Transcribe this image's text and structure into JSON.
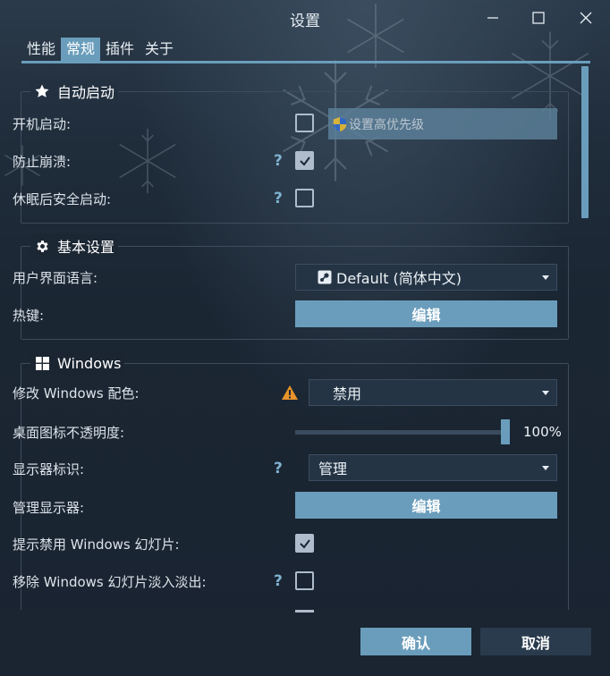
{
  "window": {
    "title": "设置"
  },
  "tabs": [
    "性能",
    "常规",
    "插件",
    "关于"
  ],
  "active_tab": "常规",
  "groups": {
    "autostart": {
      "title": "自动启动",
      "icon": "star-icon",
      "boot_label": "开机启动:",
      "boot_checked": false,
      "priority_button": "设置高优先级",
      "crash_label": "防止崩溃:",
      "crash_help": "?",
      "crash_checked": true,
      "sleep_label": "休眠后安全启动:",
      "sleep_help": "?",
      "sleep_checked": false
    },
    "basic": {
      "title": "基本设置",
      "icon": "gear-icon",
      "lang_label": "用户界面语言:",
      "lang_value": "Default (简体中文)",
      "hotkey_label": "热键:",
      "hotkey_button": "编辑"
    },
    "windows": {
      "title": "Windows",
      "icon": "windows-logo-icon",
      "color_label": "修改 Windows 配色:",
      "color_value": "禁用",
      "opacity_label": "桌面图标不透明度:",
      "opacity_value": "100%",
      "opacity_fraction": 1.0,
      "display_id_label": "显示器标识:",
      "display_id_help": "?",
      "display_id_value": "管理",
      "manage_display_label": "管理显示器:",
      "manage_display_button": "编辑",
      "slideshow_hint_label": "提示禁用 Windows 幻灯片:",
      "slideshow_hint_checked": true,
      "slideshow_fade_label": "移除 Windows 幻灯片淡入淡出:",
      "slideshow_fade_help": "?",
      "slideshow_fade_checked": false
    }
  },
  "footer": {
    "ok": "确认",
    "cancel": "取消"
  },
  "colors": {
    "accent": "#6a9dbb",
    "background": "#1a2532",
    "warning": "#e8932a"
  }
}
